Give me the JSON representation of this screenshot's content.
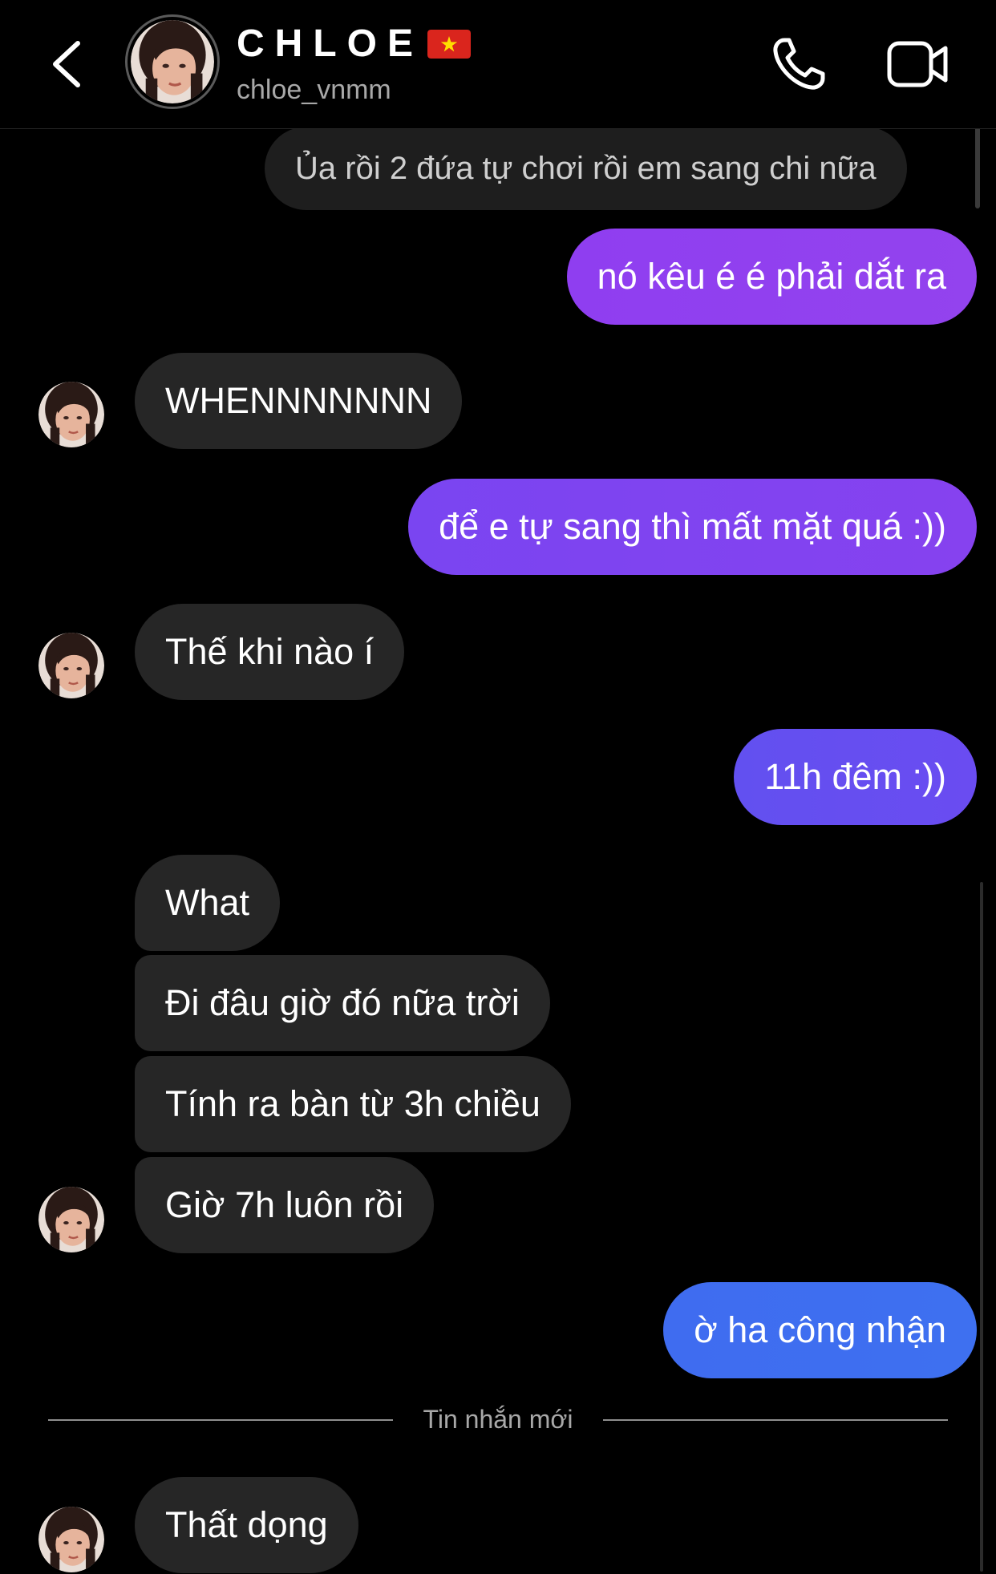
{
  "header": {
    "name": "CHLOE",
    "handle": "chloe_vnmm",
    "flag_colors": {
      "field": "#da251d",
      "star": "#ffde00"
    }
  },
  "icons": {
    "back": "chevron-left-icon",
    "call": "phone-icon",
    "video": "video-camera-icon"
  },
  "colors": {
    "background": "#000000",
    "incoming_bubble": "#262626",
    "outgoing_gradient": [
      "#8f3ef0",
      "#7a47f2",
      "#6750f0",
      "#4f63ee",
      "#3e6ff0"
    ]
  },
  "messages": [
    {
      "side": "out-reply",
      "text": "Ủa rồi 2 đứa tự chơi rồi em sang chi nữa"
    },
    {
      "side": "out",
      "text": "nó kêu é é phải dắt ra"
    },
    {
      "side": "in",
      "text": "WHENNNNNNN"
    },
    {
      "side": "out",
      "text": "để e tự sang thì mất mặt quá :))"
    },
    {
      "side": "in",
      "text": "Thế khi nào í"
    },
    {
      "side": "out",
      "text": "11h đêm :))"
    },
    {
      "side": "in",
      "text": "What"
    },
    {
      "side": "in",
      "text": "Đi đâu giờ đó nữa trời"
    },
    {
      "side": "in",
      "text": "Tính ra bàn từ 3h chiều"
    },
    {
      "side": "in",
      "text": "Giờ 7h luôn rồi"
    },
    {
      "side": "out",
      "text": "ờ ha công nhận"
    },
    {
      "side": "in",
      "text": "Thất dọng"
    }
  ],
  "divider": {
    "label": "Tin nhắn mới"
  }
}
